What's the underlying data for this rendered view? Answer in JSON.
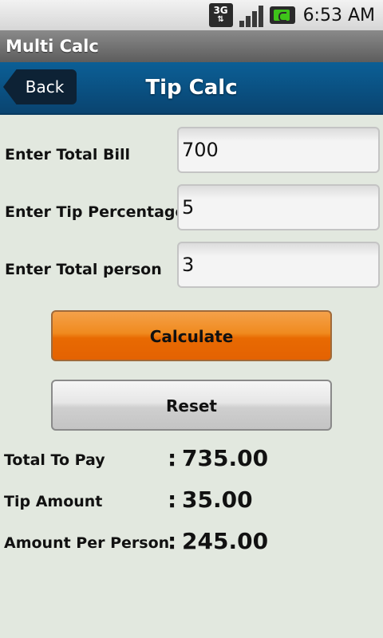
{
  "status_bar": {
    "network": "3G",
    "time": "6:53 AM"
  },
  "app_title": "Multi Calc",
  "header": {
    "back_label": "Back",
    "title": "Tip Calc"
  },
  "form": {
    "bill_label": "Enter Total Bill",
    "bill_value": "700",
    "tip_label": "Enter Tip Percentage",
    "tip_value": "5",
    "person_label": "Enter Total person",
    "person_value": "3"
  },
  "buttons": {
    "calculate": "Calculate",
    "reset": "Reset"
  },
  "results": {
    "colon": ":",
    "total_label": "Total To Pay",
    "total_value": "735.00",
    "tip_label": "Tip Amount",
    "tip_value": "35.00",
    "per_person_label": "Amount Per Person",
    "per_person_value": "245.00"
  },
  "colors": {
    "header_blue": "#0b5f96",
    "calc_orange": "#f08a1e",
    "background": "#e2e8df"
  }
}
